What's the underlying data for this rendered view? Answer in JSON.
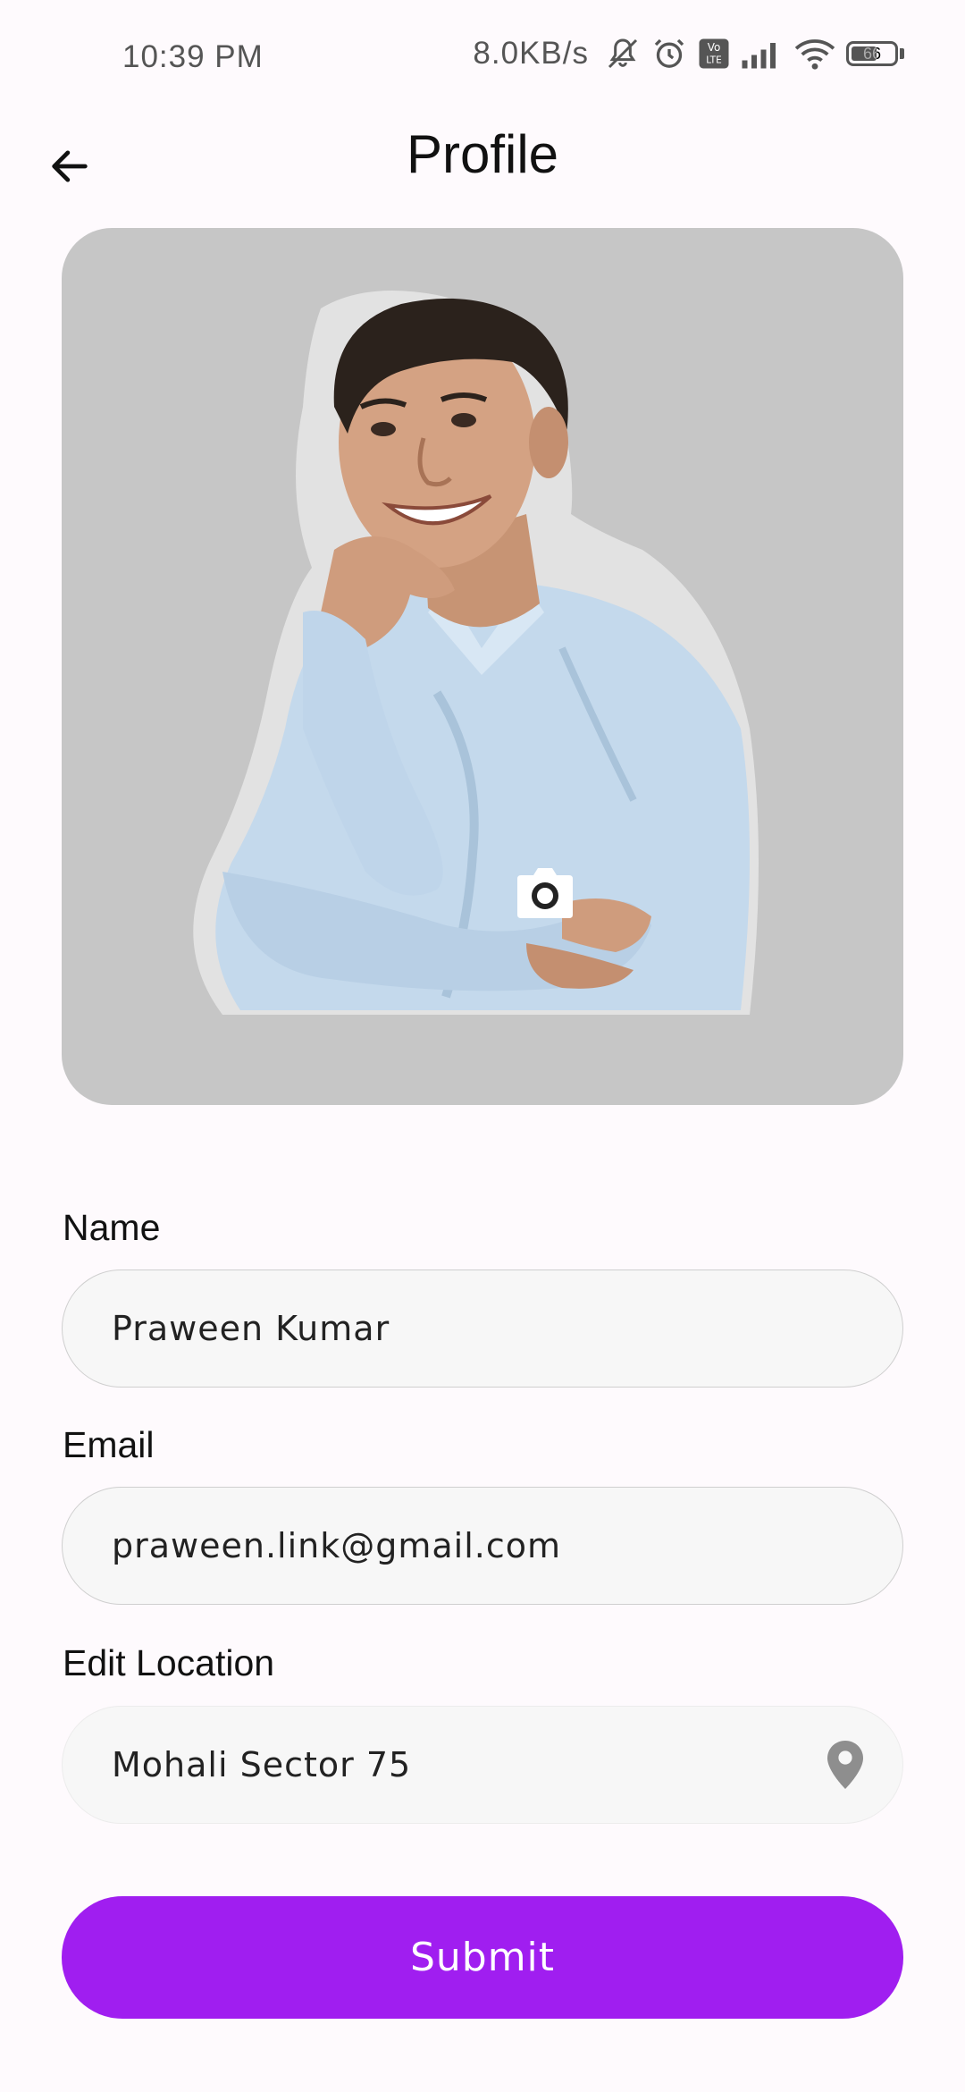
{
  "status_bar": {
    "time": "10:39 PM",
    "net_speed": "8.0KB/s",
    "icons": [
      "mute-icon",
      "alarm-icon",
      "volte-icon",
      "signal-icon",
      "wifi-icon",
      "battery-icon"
    ],
    "volte_label": "Vo\nLTE",
    "battery_level": "66",
    "battery_fraction": 0.66
  },
  "app_bar": {
    "back_icon": "arrow-left-icon",
    "title": "Profile"
  },
  "profile_photo": {
    "overlay_icon": "camera-icon",
    "background_color": "#c6c6c6",
    "shirt_color": "#c4d9ec"
  },
  "form": {
    "name": {
      "label": "Name",
      "value": "Praween Kumar"
    },
    "email": {
      "label": "Email",
      "value": "praween.link@gmail.com"
    },
    "location": {
      "label": "Edit Location",
      "value": "Mohali Sector 75",
      "icon": "location-pin-icon"
    }
  },
  "submit": {
    "label": "Submit",
    "color": "#a01ef0"
  }
}
